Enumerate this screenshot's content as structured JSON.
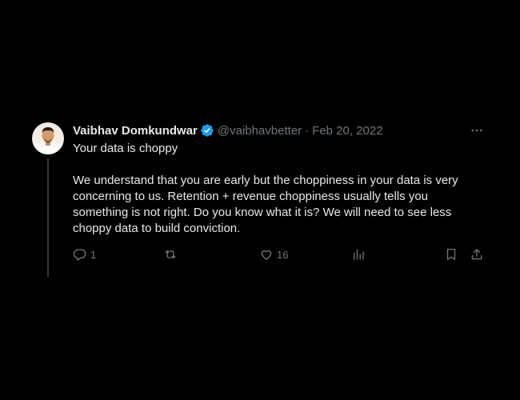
{
  "author": {
    "name": "Vaibhav Domkundwar",
    "handle": "@vaibhavbetter",
    "separator": "·",
    "date": "Feb 20, 2022"
  },
  "tweet": {
    "line1": "Your data is choppy",
    "line2": "We understand that you are early but the choppiness in your data is very",
    "line3": "concerning to us. Retention  + revenue choppiness usually tells you",
    "line4": "something is not right. Do you know what it is? We will need to see less",
    "line5": "choppy data to build conviction."
  },
  "actions": {
    "reply_count": "1",
    "retweet_count": "",
    "like_count": "16"
  },
  "colors": {
    "background": "#000000",
    "text_primary": "#e7e9ea",
    "text_secondary": "#71767b",
    "verified_badge": "#1d9bf0",
    "thread_line": "#333639"
  },
  "icons": [
    "verified-badge-icon",
    "more-icon",
    "reply-icon",
    "retweet-icon",
    "like-icon",
    "views-icon",
    "bookmark-icon",
    "share-icon"
  ]
}
